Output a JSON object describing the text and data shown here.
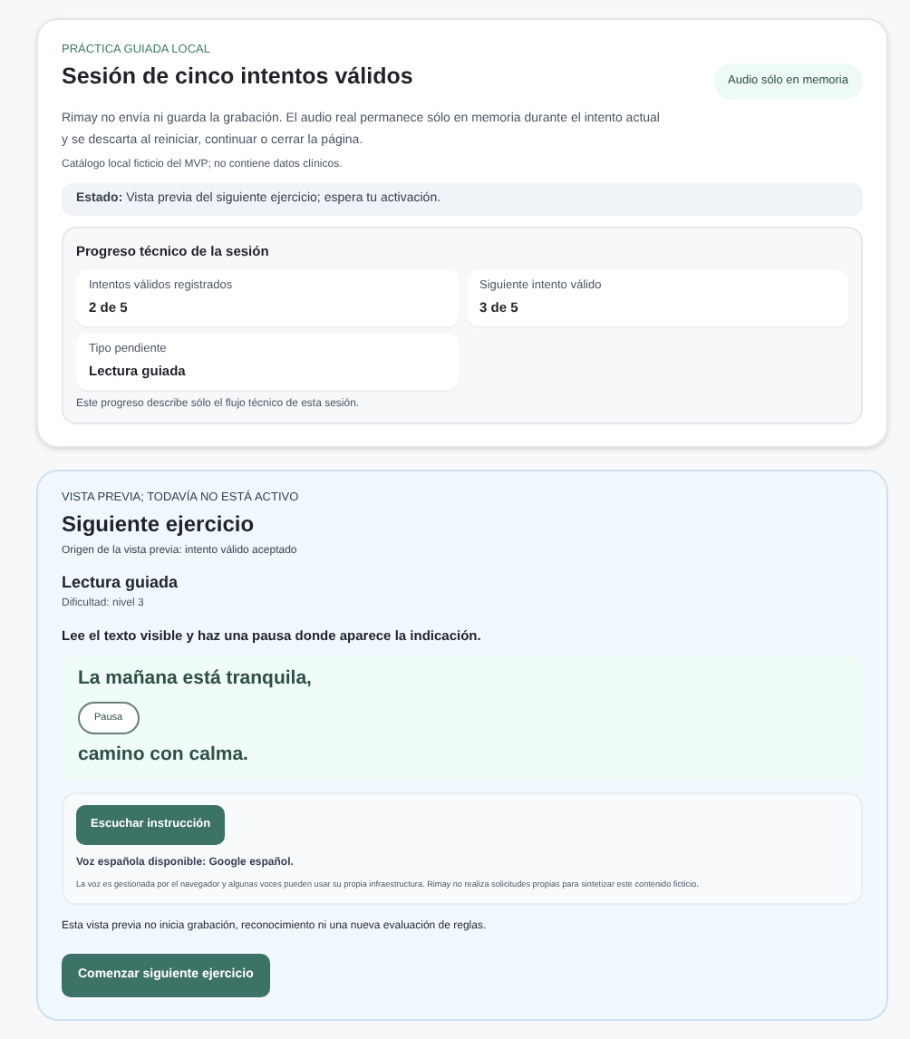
{
  "session": {
    "eyebrow": "PRÁCTICA GUIADA LOCAL",
    "title": "Sesión de cinco intentos válidos",
    "badge": "Audio sólo en memoria",
    "description": "Rimay no envía ni guarda la grabación. El audio real permanece sólo en memoria durante el intento actual y se descarta al reiniciar, continuar o cerrar la página.",
    "catalog_note": "Catálogo local ficticio del MVP; no contiene datos clínicos.",
    "status": "**Estado:** Vista previa del siguiente ejercicio; espera tu activación.",
    "progress": {
      "title": "Progreso técnico de la sesión",
      "stats": [
        {
          "label": "Intentos válidos registrados",
          "value": "2 de 5"
        },
        {
          "label": "Siguiente intento válido",
          "value": "3 de 5"
        },
        {
          "label": "Tipo pendiente",
          "value": "Lectura guiada"
        }
      ],
      "note": "Este progreso describe sólo el flujo técnico de esta sesión."
    }
  },
  "preview": {
    "eyebrow": "VISTA PREVIA; TODAVÍA NO ESTÁ ACTIVO",
    "title": "Siguiente ejercicio",
    "origin": "Origen de la vista previa: intento válido aceptado",
    "exercise_title": "Lectura guiada",
    "difficulty": "Dificultad: nivel 3",
    "instruction": "Lee el texto visible y haz una pausa donde aparece la indicación.",
    "reading": [
      {
        "kind": "text",
        "text": "La mañana está tranquila,"
      },
      {
        "kind": "pause",
        "text": "Pausa"
      },
      {
        "kind": "text",
        "text": "camino con calma."
      }
    ],
    "audio": {
      "button": "Escuchar instrucción",
      "voice": "Voz española disponible: Google español.",
      "note": "La voz es gestionada por el navegador y algunas voces pueden usar su propia infraestructura. Rimay no realiza solicitudes propias para sintetizar este contenido ficticio."
    },
    "footer_note": "Esta vista previa no inicia grabación, reconocimiento ni una nueva evaluación de reglas.",
    "start_button": "Comenzar siguiente ejercicio"
  }
}
